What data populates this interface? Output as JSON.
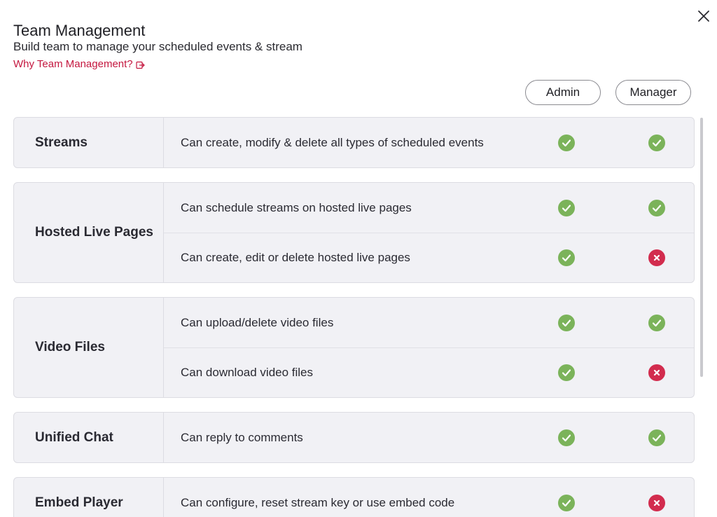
{
  "header": {
    "title": "Team Management",
    "subtitle": "Build team to manage your scheduled events & stream",
    "why_link": "Why Team Management?"
  },
  "roles": {
    "admin": "Admin",
    "manager": "Manager"
  },
  "colors": {
    "accent": "#c4173f",
    "allowed": "#7bb35a",
    "denied": "#d22c4e"
  },
  "groups": [
    {
      "label": "Streams",
      "rows": [
        {
          "text": "Can create, modify & delete all types of scheduled events",
          "admin": "allowed",
          "manager": "allowed"
        }
      ]
    },
    {
      "label": "Hosted Live Pages",
      "rows": [
        {
          "text": "Can schedule streams on hosted live pages",
          "admin": "allowed",
          "manager": "allowed"
        },
        {
          "text": "Can create, edit or delete hosted live pages",
          "admin": "allowed",
          "manager": "denied"
        }
      ]
    },
    {
      "label": "Video Files",
      "rows": [
        {
          "text": "Can upload/delete video files",
          "admin": "allowed",
          "manager": "allowed"
        },
        {
          "text": "Can download video files",
          "admin": "allowed",
          "manager": "denied"
        }
      ]
    },
    {
      "label": "Unified Chat",
      "rows": [
        {
          "text": "Can reply to comments",
          "admin": "allowed",
          "manager": "allowed"
        }
      ]
    },
    {
      "label": "Embed Player",
      "rows": [
        {
          "text": "Can configure, reset stream key or use embed code",
          "admin": "allowed",
          "manager": "denied"
        }
      ]
    }
  ]
}
